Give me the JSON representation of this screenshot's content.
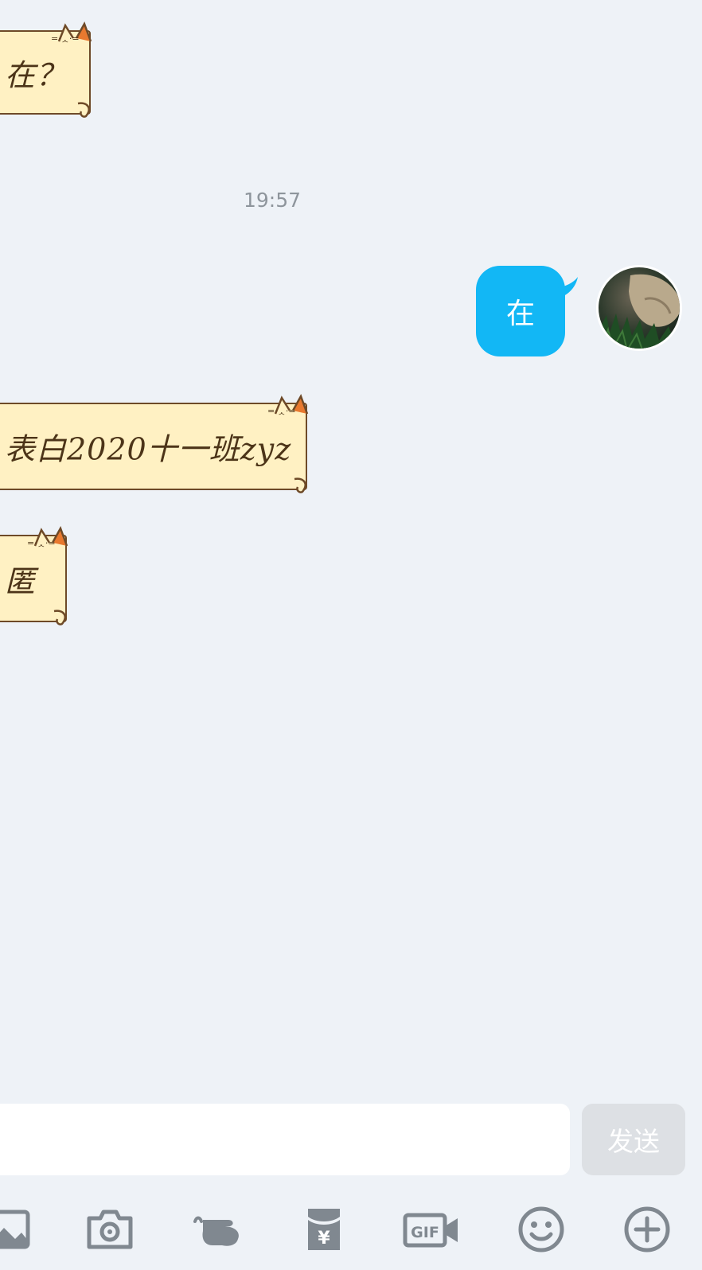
{
  "messages": [
    {
      "from": "other",
      "text": "在？",
      "style": "cat-stationery"
    },
    {
      "type": "time",
      "text": "19:57"
    },
    {
      "from": "me",
      "text": "在"
    },
    {
      "from": "other",
      "text": "表白2020十一班zyz",
      "style": "cat-stationery"
    },
    {
      "from": "other",
      "text": "匿",
      "style": "cat-stationery"
    }
  ],
  "composer": {
    "input_value": "",
    "send_label": "发送"
  },
  "toolbar": {
    "items": [
      {
        "icon": "image-icon"
      },
      {
        "icon": "camera-icon"
      },
      {
        "icon": "poke-hand-icon"
      },
      {
        "icon": "red-packet-icon"
      },
      {
        "icon": "gif-icon",
        "label": "GIF"
      },
      {
        "icon": "emoji-icon"
      },
      {
        "icon": "plus-icon"
      }
    ]
  },
  "colors": {
    "background": "#eef2f7",
    "my_bubble": "#12b7f5",
    "cat_paper": "#fff1c3",
    "cat_border": "#6e4a28",
    "cat_ear": "#e8792f",
    "icon": "#808890"
  }
}
